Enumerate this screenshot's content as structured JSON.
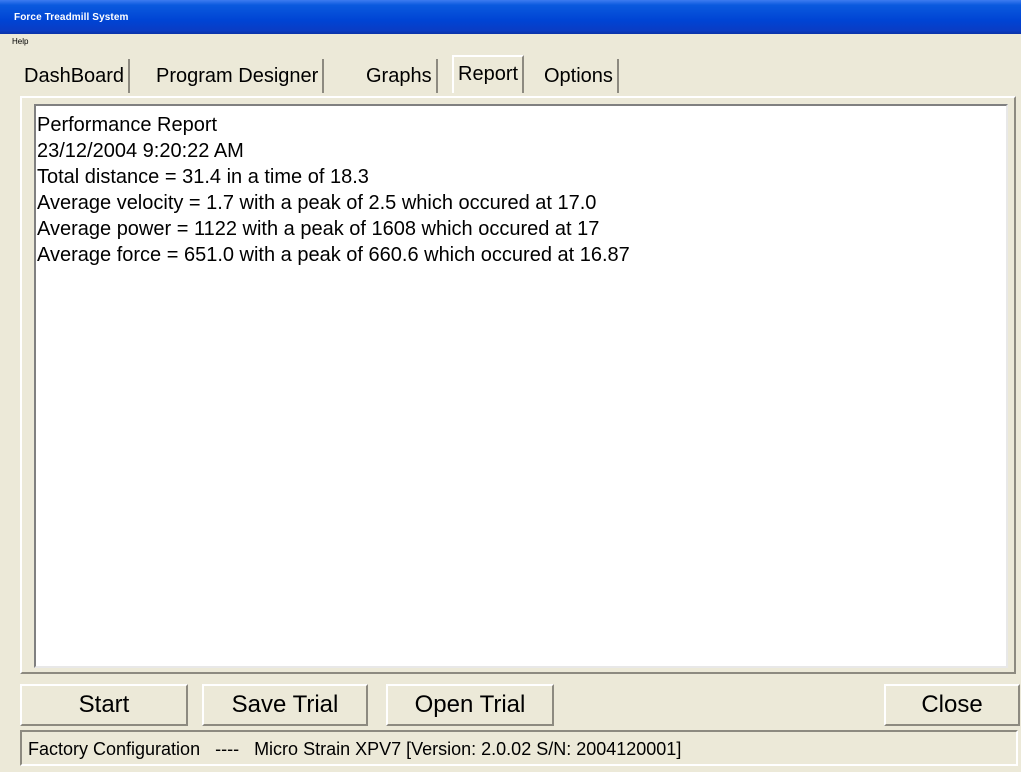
{
  "window": {
    "title": "Force Treadmill System"
  },
  "menubar": {
    "items": [
      {
        "label": "Help"
      }
    ]
  },
  "tabs": [
    {
      "label": "DashBoard",
      "active": false
    },
    {
      "label": "Program Designer",
      "active": false
    },
    {
      "label": "Graphs",
      "active": false
    },
    {
      "label": "Report",
      "active": true
    },
    {
      "label": "Options",
      "active": false
    }
  ],
  "report": {
    "lines": [
      "Performance Report",
      "23/12/2004 9:20:22 AM",
      "Total distance = 31.4 in a time of 18.3",
      "Average velocity = 1.7 with a peak of 2.5 which occured at 17.0",
      "Average power = 1122 with a peak of 1608 which occured at 17",
      "Average force = 651.0 with a peak of 660.6 which occured at 16.87"
    ]
  },
  "buttons": {
    "start": "Start",
    "save_trial": "Save Trial",
    "open_trial": "Open Trial",
    "close": "Close"
  },
  "statusbar": {
    "text": "Factory Configuration   ----   Micro Strain XPV7 [Version: 2.0.02 S/N: 2004120001]"
  },
  "colors": {
    "titlebar": "#0a44d4",
    "window_face": "#ece9d8",
    "report_background": "#ffffff"
  }
}
